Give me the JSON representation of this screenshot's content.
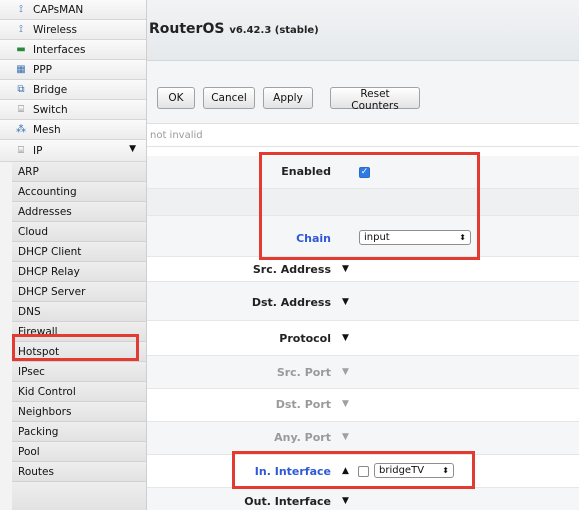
{
  "sidebar": {
    "top_items": [
      {
        "label": "CAPsMAN",
        "icon": "capsman-icon",
        "glyph": "⟟"
      },
      {
        "label": "Wireless",
        "icon": "wireless-icon",
        "glyph": "⟟"
      },
      {
        "label": "Interfaces",
        "icon": "interfaces-icon",
        "glyph": "▬"
      },
      {
        "label": "PPP",
        "icon": "ppp-icon",
        "glyph": "▦"
      },
      {
        "label": "Bridge",
        "icon": "bridge-icon",
        "glyph": "⧉"
      },
      {
        "label": "Switch",
        "icon": "switch-icon",
        "glyph": "⌸"
      },
      {
        "label": "Mesh",
        "icon": "mesh-icon",
        "glyph": "⁂"
      },
      {
        "label": "IP",
        "icon": "ip-icon",
        "glyph": "⌸"
      }
    ],
    "ip_submenu": [
      "ARP",
      "Accounting",
      "Addresses",
      "Cloud",
      "DHCP Client",
      "DHCP Relay",
      "DHCP Server",
      "DNS",
      "Firewall",
      "Hotspot",
      "IPsec",
      "Kid Control",
      "Neighbors",
      "Packing",
      "Pool",
      "Routes"
    ]
  },
  "header": {
    "title": "RouterOS",
    "version": "v6.42.3 (stable)"
  },
  "toolbar": {
    "ok": "OK",
    "cancel": "Cancel",
    "apply": "Apply",
    "reset_counters": "Reset Counters"
  },
  "status": "not invalid",
  "form": {
    "enabled_label": "Enabled",
    "enabled": true,
    "chain_label": "Chain",
    "chain_value": "input",
    "src_address_label": "Src. Address",
    "dst_address_label": "Dst. Address",
    "protocol_label": "Protocol",
    "src_port_label": "Src. Port",
    "dst_port_label": "Dst. Port",
    "any_port_label": "Any. Port",
    "in_interface_label": "In. Interface",
    "in_interface_value": "bridgeTV",
    "in_interface_invert": false,
    "out_interface_label": "Out. Interface"
  },
  "colors": {
    "highlight": "#e13b32",
    "label_blue": "#2f58d6",
    "checkbox_blue": "#2f7be5"
  }
}
